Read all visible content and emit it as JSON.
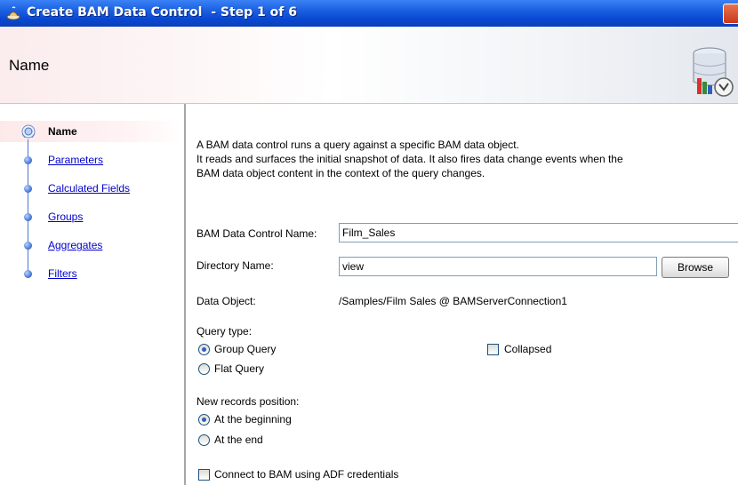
{
  "window": {
    "title": "Create BAM Data Control  - Step 1 of 6"
  },
  "header": {
    "page_title": "Name"
  },
  "nav": {
    "items": [
      {
        "label": "Name"
      },
      {
        "label": "Parameters"
      },
      {
        "label": "Calculated Fields"
      },
      {
        "label": "Groups"
      },
      {
        "label": "Aggregates"
      },
      {
        "label": "Filters"
      }
    ]
  },
  "main": {
    "description": [
      "A BAM data control runs a query against a specific BAM data object.",
      "It reads and surfaces the initial snapshot of data. It also fires data change events when the",
      "BAM data object content in the context of the query changes."
    ],
    "control_name": {
      "label": "BAM Data Control Name:",
      "value": "Film_Sales"
    },
    "directory_name": {
      "label": "Directory Name:",
      "value": "view"
    },
    "browse_label": "Browse",
    "data_object": {
      "label": "Data Object:",
      "value": "/Samples/Film Sales @ BAMServerConnection1"
    },
    "query_type": {
      "label": "Query type:",
      "options": [
        "Group Query",
        "Flat Query"
      ],
      "selected": "Group Query"
    },
    "collapsed": {
      "label": "Collapsed",
      "checked": false
    },
    "new_records_position": {
      "label": "New records position:",
      "options": [
        "At the beginning",
        "At the end"
      ],
      "selected": "At the beginning"
    },
    "adf_credentials": {
      "label": "Connect to BAM using ADF credentials",
      "checked": false
    }
  },
  "colors": {
    "titlebar": "#0a49d4",
    "link": "#0000cc",
    "nav_dot": "#3e6ccc"
  }
}
